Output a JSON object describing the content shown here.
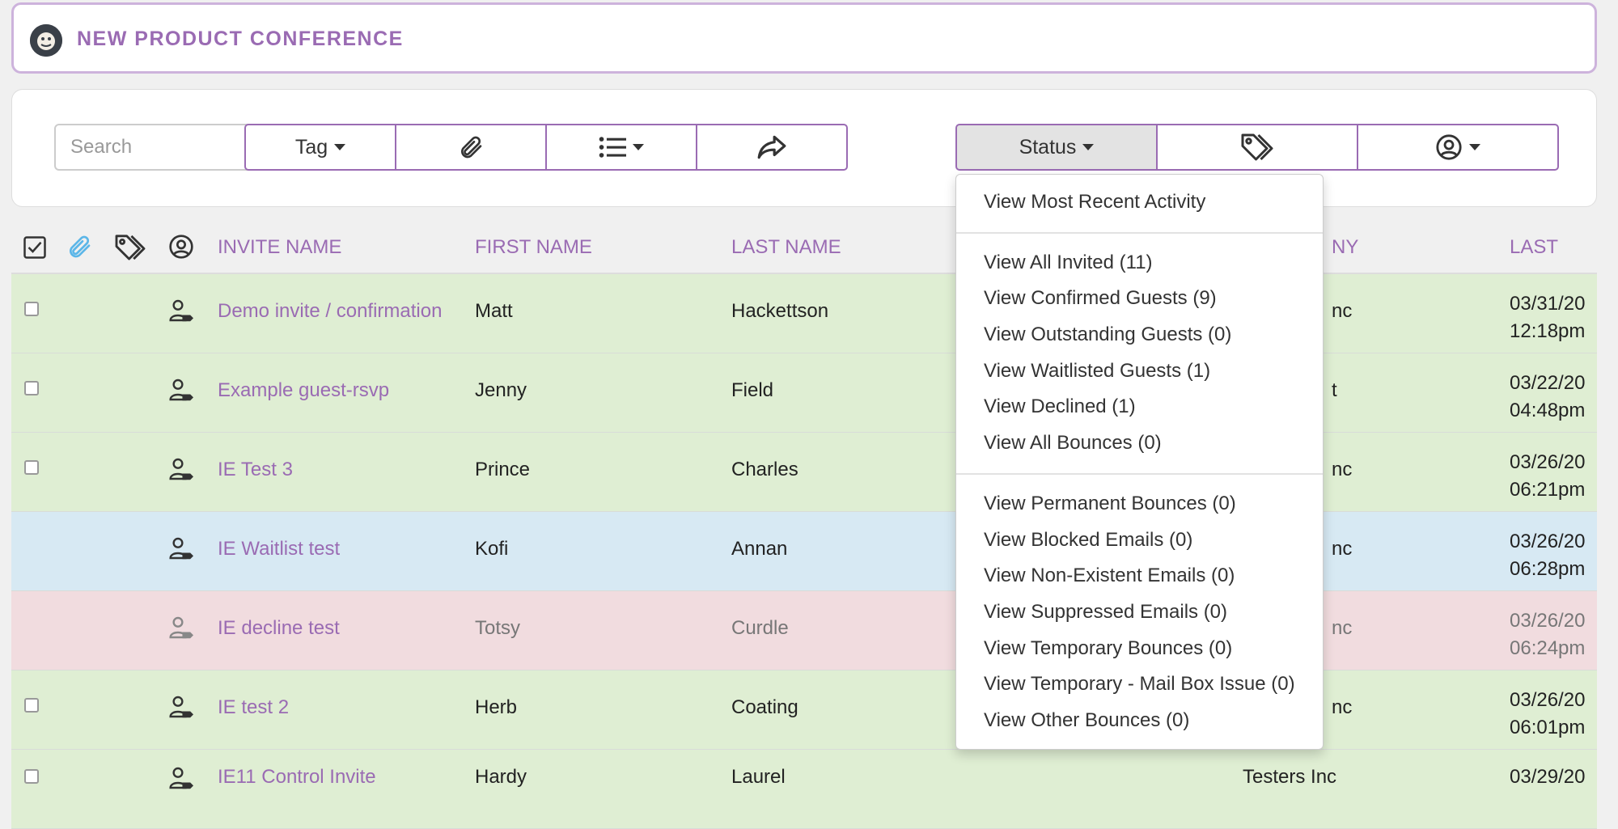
{
  "header": {
    "title": "NEW PRODUCT CONFERENCE"
  },
  "toolbar": {
    "search_placeholder": "Search",
    "tag_label": "Tag",
    "status_label": "Status"
  },
  "table": {
    "columns": {
      "invite_name": "INVITE NAME",
      "first_name": "FIRST NAME",
      "last_name": "LAST NAME",
      "company_partial": "NY",
      "last": "LAST"
    },
    "rows": [
      {
        "invite": "Demo invite / confirmation",
        "first": "Matt",
        "last": "Hackettson",
        "company": "nc",
        "date": "03/31/20",
        "time": "12:18pm"
      },
      {
        "invite": "Example guest-rsvp",
        "first": "Jenny",
        "last": "Field",
        "company": "t",
        "date": "03/22/20",
        "time": "04:48pm"
      },
      {
        "invite": "IE Test 3",
        "first": "Prince",
        "last": "Charles",
        "company": "nc",
        "date": "03/26/20",
        "time": "06:21pm"
      },
      {
        "invite": "IE Waitlist test",
        "first": "Kofi",
        "last": "Annan",
        "company": "nc",
        "date": "03/26/20",
        "time": "06:28pm"
      },
      {
        "invite": "IE decline test",
        "first": "Totsy",
        "last": "Curdle",
        "company": "nc",
        "date": "03/26/20",
        "time": "06:24pm"
      },
      {
        "invite": "IE test 2",
        "first": "Herb",
        "last": "Coating",
        "company": "nc",
        "date": "03/26/20",
        "time": "06:01pm"
      },
      {
        "invite": "IE11 Control Invite",
        "first": "Hardy",
        "last": "Laurel",
        "company": "Testers Inc",
        "date": "03/29/20",
        "time": ""
      }
    ]
  },
  "status_menu": {
    "group1": [
      "View Most Recent Activity"
    ],
    "group2": [
      "View All Invited (11)",
      "View Confirmed Guests (9)",
      "View Outstanding Guests (0)",
      "View Waitlisted Guests (1)",
      "View Declined (1)",
      "View All Bounces (0)"
    ],
    "group3": [
      "View Permanent Bounces (0)",
      "View Blocked Emails (0)",
      "View Non-Existent Emails (0)",
      "View Suppressed Emails (0)",
      "View Temporary Bounces (0)",
      "View Temporary - Mail Box Issue (0)",
      "View Other Bounces (0)"
    ]
  },
  "colors": {
    "accent": "#9a6bb3",
    "row_confirmed": "#dfeed3",
    "row_waitlisted": "#d7e9f3",
    "row_declined": "#f1dcdf"
  }
}
